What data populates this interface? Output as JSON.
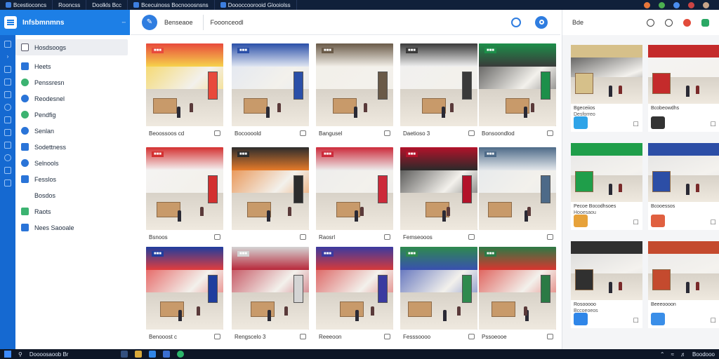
{
  "browser": {
    "tabs": [
      {
        "label": "Bcestioconcs"
      },
      {
        "label": "Rooncss"
      },
      {
        "label": "Doolkls Bcc"
      },
      {
        "label": "Bcecuinoss Bocnooosnsns"
      },
      {
        "label": "Doooccoorooid Glooiolss"
      }
    ]
  },
  "sidebar": {
    "title": "Infsbmnmns",
    "items": [
      {
        "label": "Hosdsoogs",
        "icon": "document-icon"
      },
      {
        "label": "Heets",
        "icon": "bag-icon"
      },
      {
        "label": "Penssresn",
        "icon": "user-icon"
      },
      {
        "label": "Reodesnel",
        "icon": "gauge-icon"
      },
      {
        "label": "Pendfig",
        "icon": "gauge-icon"
      },
      {
        "label": "Senlan",
        "icon": "search-icon"
      },
      {
        "label": "Sodettness",
        "icon": "store-icon"
      },
      {
        "label": "Selnools",
        "icon": "clock-icon"
      },
      {
        "label": "Fesslos",
        "icon": "tag-icon"
      },
      {
        "label": "Bosdos",
        "icon": "list-icon"
      },
      {
        "label": "Raots",
        "icon": "chart-icon"
      },
      {
        "label": "Nees Saooale",
        "icon": "image-icon"
      }
    ]
  },
  "topbar": {
    "label": "Benseaoe",
    "search_text": "Fooonceodl"
  },
  "grid": {
    "captions": [
      "Beoossoos cd",
      "Bocoooold",
      "Bangusel",
      "Daetioso 3",
      "Bonsoondlod",
      "Bsnoos",
      "",
      "Raosrl",
      "Femseooos",
      "",
      "Benooost c",
      "Rengscelo 3",
      "Reeeoon",
      "Fesssoooo",
      "Pssoeooe"
    ]
  },
  "rpanel": {
    "label": "Bde",
    "cards": [
      {
        "title": "Bgeceiios",
        "sub": "Desforreo"
      },
      {
        "title": "Bcobeowdhs",
        "sub": ""
      },
      {
        "title": "Pecoe Bocodhsoes",
        "sub": "Hooesaou"
      },
      {
        "title": "Bcooessos",
        "sub": ""
      },
      {
        "title": "Rosooooo",
        "sub": "Bccoeoeos"
      },
      {
        "title": "Beeeoooon",
        "sub": ""
      }
    ]
  },
  "taskbar": {
    "search_text": "Doooosaoob Br",
    "clock": "Boodooo"
  }
}
